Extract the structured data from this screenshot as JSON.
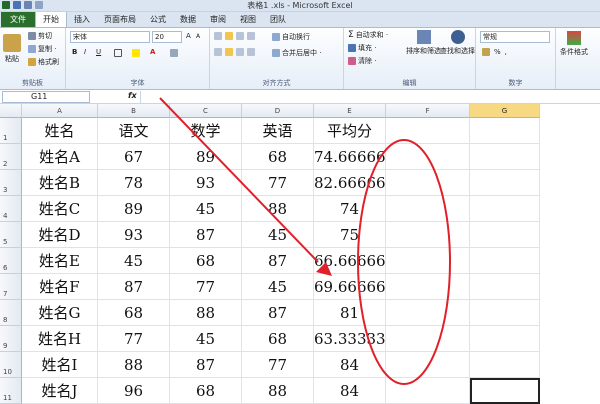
{
  "app": {
    "window_title": "表格1 .xls - Microsoft Excel",
    "tabs": [
      "文件",
      "开始",
      "插入",
      "页面布局",
      "公式",
      "数据",
      "审阅",
      "视图",
      "团队"
    ],
    "active_tab": "开始"
  },
  "ribbon": {
    "clipboard": {
      "cut": "剪切",
      "copy": "复制 ·",
      "format_painter": "格式刷",
      "paste": "粘贴",
      "label": "剪贴板"
    },
    "font": {
      "name": "宋体",
      "size": "20",
      "label": "字体",
      "bold": "B",
      "italic": "I",
      "underline": "U"
    },
    "alignment": {
      "wrap": "自动换行",
      "merge": "合并后居中 ·",
      "label": "对齐方式"
    },
    "editing": {
      "autosum": "自动求和 ·",
      "fill": "填充 ·",
      "clear": "清除 ·",
      "sort": "排序和筛选",
      "find": "查找和选择",
      "label": "编辑"
    },
    "number": {
      "format": "常规",
      "label": "数字"
    },
    "styles": {
      "conditional": "条件格式"
    }
  },
  "formula_bar": {
    "name_box": "G11",
    "fx": "fx",
    "value": ""
  },
  "sheet": {
    "columns": [
      "A",
      "B",
      "C",
      "D",
      "E",
      "F",
      "G"
    ],
    "selected_column": "G",
    "row_numbers": [
      "1",
      "2",
      "3",
      "4",
      "5",
      "6",
      "7",
      "8",
      "9",
      "10",
      "11"
    ],
    "rows": [
      [
        "姓名",
        "语文",
        "数学",
        "英语",
        "平均分"
      ],
      [
        "姓名A",
        "67",
        "89",
        "68",
        "74.666667"
      ],
      [
        "姓名B",
        "78",
        "93",
        "77",
        "82.666667"
      ],
      [
        "姓名C",
        "89",
        "45",
        "88",
        "74"
      ],
      [
        "姓名D",
        "93",
        "87",
        "45",
        "75"
      ],
      [
        "姓名E",
        "45",
        "68",
        "87",
        "66.666667"
      ],
      [
        "姓名F",
        "87",
        "77",
        "45",
        "69.666667"
      ],
      [
        "姓名G",
        "68",
        "88",
        "87",
        "81"
      ],
      [
        "姓名H",
        "77",
        "45",
        "68",
        "63.333333"
      ],
      [
        "姓名I",
        "88",
        "87",
        "77",
        "84"
      ],
      [
        "姓名J",
        "96",
        "68",
        "88",
        "84"
      ]
    ]
  },
  "colors": {
    "file_tab": "#2a6f2b",
    "annotation": "#e0202a",
    "selected_header": "#f8d983"
  }
}
